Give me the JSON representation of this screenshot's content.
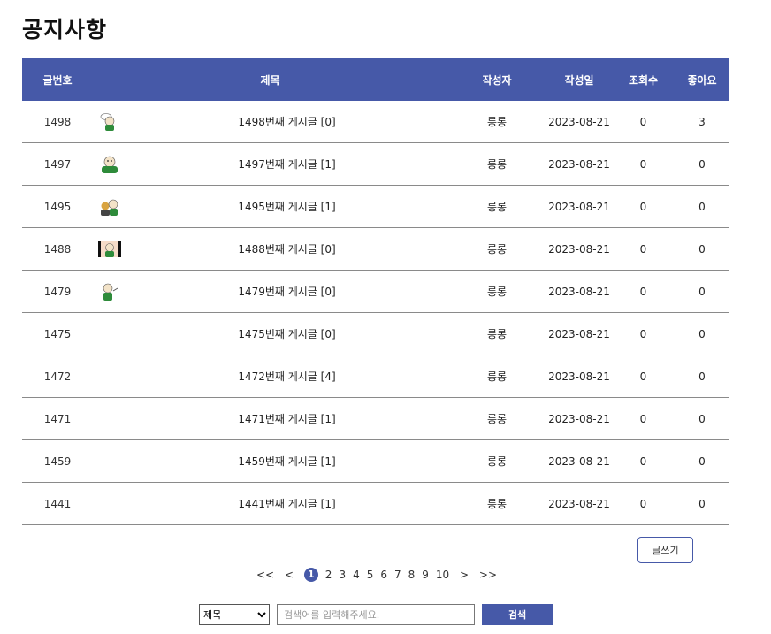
{
  "page": {
    "title": "공지사항"
  },
  "table": {
    "headers": {
      "num": "글번호",
      "title": "제목",
      "author": "작성자",
      "date": "작성일",
      "views": "조회수",
      "likes": "좋아요"
    },
    "rows": [
      {
        "num": "1498",
        "title": "1498번째 게시글 [0]",
        "author": "롱롱",
        "date": "2023-08-21",
        "views": "0",
        "likes": "3",
        "thumb": "character-icon-1"
      },
      {
        "num": "1497",
        "title": "1497번째 게시글 [1]",
        "author": "롱롱",
        "date": "2023-08-21",
        "views": "0",
        "likes": "0",
        "thumb": "character-icon-2"
      },
      {
        "num": "1495",
        "title": "1495번째 게시글 [1]",
        "author": "롱롱",
        "date": "2023-08-21",
        "views": "0",
        "likes": "0",
        "thumb": "character-icon-3"
      },
      {
        "num": "1488",
        "title": "1488번째 게시글 [0]",
        "author": "롱롱",
        "date": "2023-08-21",
        "views": "0",
        "likes": "0",
        "thumb": "character-icon-4"
      },
      {
        "num": "1479",
        "title": "1479번째 게시글 [0]",
        "author": "롱롱",
        "date": "2023-08-21",
        "views": "0",
        "likes": "0",
        "thumb": "character-icon-5"
      },
      {
        "num": "1475",
        "title": "1475번째 게시글 [0]",
        "author": "롱롱",
        "date": "2023-08-21",
        "views": "0",
        "likes": "0",
        "thumb": ""
      },
      {
        "num": "1472",
        "title": "1472번째 게시글 [4]",
        "author": "롱롱",
        "date": "2023-08-21",
        "views": "0",
        "likes": "0",
        "thumb": ""
      },
      {
        "num": "1471",
        "title": "1471번째 게시글 [1]",
        "author": "롱롱",
        "date": "2023-08-21",
        "views": "0",
        "likes": "0",
        "thumb": ""
      },
      {
        "num": "1459",
        "title": "1459번째 게시글 [1]",
        "author": "롱롱",
        "date": "2023-08-21",
        "views": "0",
        "likes": "0",
        "thumb": ""
      },
      {
        "num": "1441",
        "title": "1441번째 게시글 [1]",
        "author": "롱롱",
        "date": "2023-08-21",
        "views": "0",
        "likes": "0",
        "thumb": ""
      }
    ]
  },
  "actions": {
    "write_label": "글쓰기"
  },
  "pagination": {
    "first": "<<",
    "prev": "<",
    "pages": [
      "1",
      "2",
      "3",
      "4",
      "5",
      "6",
      "7",
      "8",
      "9",
      "10"
    ],
    "current": "1",
    "next": ">",
    "last": ">>"
  },
  "search": {
    "select_value": "제목",
    "placeholder": "검색어를 입력해주세요.",
    "button_label": "검색"
  },
  "colors": {
    "accent": "#4659a8"
  }
}
